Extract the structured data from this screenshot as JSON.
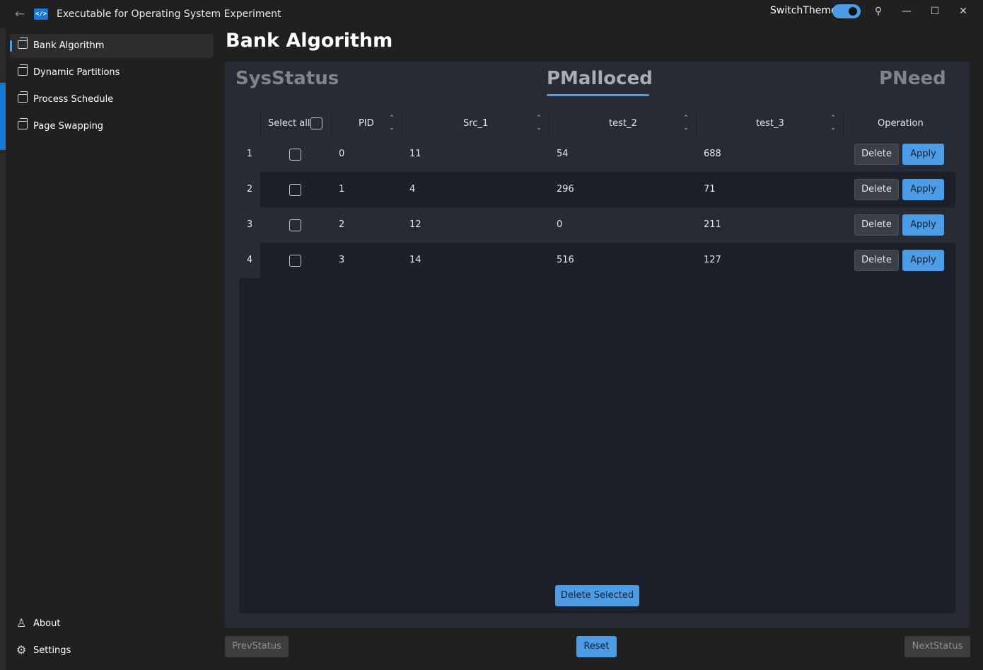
{
  "window": {
    "title": "Executable for Operating System Experiment",
    "back_icon": "arrow-left-icon",
    "app_icon_glyph": "</>",
    "switch_theme_label": "SwitchTheme",
    "switch_theme_on": true,
    "controls": {
      "pin": "📌",
      "minimize": "—",
      "maximize": "☐",
      "close": "✕"
    }
  },
  "sidebar": {
    "items": [
      {
        "label": "Bank Algorithm",
        "active": true
      },
      {
        "label": "Dynamic Partitions",
        "active": false
      },
      {
        "label": "Process Schedule",
        "active": false
      },
      {
        "label": "Page Swapping",
        "active": false
      }
    ],
    "footer": [
      {
        "label": "About",
        "icon": "person-icon",
        "glyph": "♙"
      },
      {
        "label": "Settings",
        "icon": "gear-icon",
        "glyph": "⚙"
      }
    ]
  },
  "main": {
    "title": "Bank Algorithm",
    "tabs": [
      "SysStatus",
      "PMalloced",
      "PNeed"
    ],
    "active_tab": "PMalloced",
    "table": {
      "select_all_label": "Select all",
      "select_all_checked": false,
      "columns": [
        "PID",
        "Src_1",
        "test_2",
        "test_3",
        "Operation"
      ],
      "rows": [
        {
          "num": "1",
          "pid": "0",
          "src_1": "11",
          "test_2": "54",
          "test_3": "688",
          "checked": false
        },
        {
          "num": "2",
          "pid": "1",
          "src_1": "4",
          "test_2": "296",
          "test_3": "71",
          "checked": false
        },
        {
          "num": "3",
          "pid": "2",
          "src_1": "12",
          "test_2": "0",
          "test_3": "211",
          "checked": false
        },
        {
          "num": "4",
          "pid": "3",
          "src_1": "14",
          "test_2": "516",
          "test_3": "127",
          "checked": false
        }
      ],
      "delete_label": "Delete",
      "apply_label": "Apply",
      "delete_selected_label": "Delete Selected"
    },
    "footer": {
      "prev_label": "PrevStatus",
      "reset_label": "Reset",
      "next_label": "NextStatus"
    }
  },
  "colors": {
    "accent": "#4c9ce6",
    "background": "#202020",
    "panel": "#262b35",
    "table_bg": "#1c202a"
  }
}
